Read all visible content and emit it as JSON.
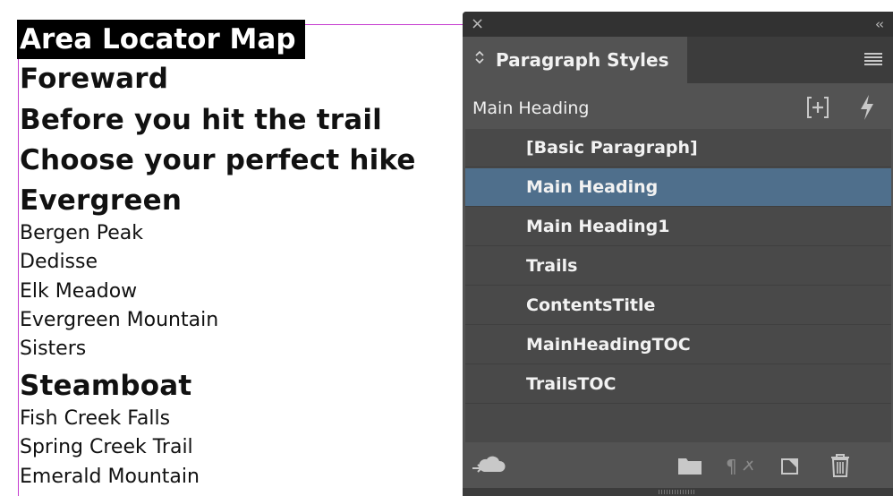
{
  "document": {
    "selected_heading": "Area Locator Map",
    "lines": [
      {
        "text": "Foreward",
        "style": "heading"
      },
      {
        "text": "Before you hit the trail",
        "style": "heading"
      },
      {
        "text": "Choose your perfect hike",
        "style": "heading"
      },
      {
        "text": "Evergreen",
        "style": "heading"
      },
      {
        "text": "Bergen Peak",
        "style": "body"
      },
      {
        "text": "Dedisse",
        "style": "body"
      },
      {
        "text": "Elk Meadow",
        "style": "body"
      },
      {
        "text": "Evergreen Mountain",
        "style": "body"
      },
      {
        "text": "Sisters",
        "style": "body"
      },
      {
        "text": "Steamboat",
        "style": "heading"
      },
      {
        "text": "Fish Creek Falls",
        "style": "body"
      },
      {
        "text": "Spring Creek Trail",
        "style": "body"
      },
      {
        "text": "Emerald Mountain",
        "style": "body"
      }
    ]
  },
  "panel": {
    "close_icon": "×",
    "collapse_icon": "‹‹",
    "tab_arrows": "⌃⌄",
    "title": "Paragraph Styles",
    "current_style": "Main Heading",
    "new_group_icon": "[+]",
    "quick_apply_icon": "ϟ",
    "styles": [
      {
        "label": "[Basic Paragraph]",
        "selected": false
      },
      {
        "label": "Main Heading",
        "selected": true
      },
      {
        "label": "Main Heading1",
        "selected": false
      },
      {
        "label": "Trails",
        "selected": false
      },
      {
        "label": "ContentsTitle",
        "selected": false
      },
      {
        "label": "MainHeadingTOC",
        "selected": false
      },
      {
        "label": "TrailsTOC",
        "selected": false
      }
    ],
    "footer_icons": {
      "cc_library": "cc-library-icon",
      "folder": "folder-icon",
      "clear_overrides": "clear-overrides-icon",
      "new_style": "new-style-icon",
      "delete": "trash-icon"
    },
    "colors": {
      "panel_bg": "#535353",
      "selected_row": "#4f6f8c",
      "frame_edge": "#c53cd0"
    }
  }
}
